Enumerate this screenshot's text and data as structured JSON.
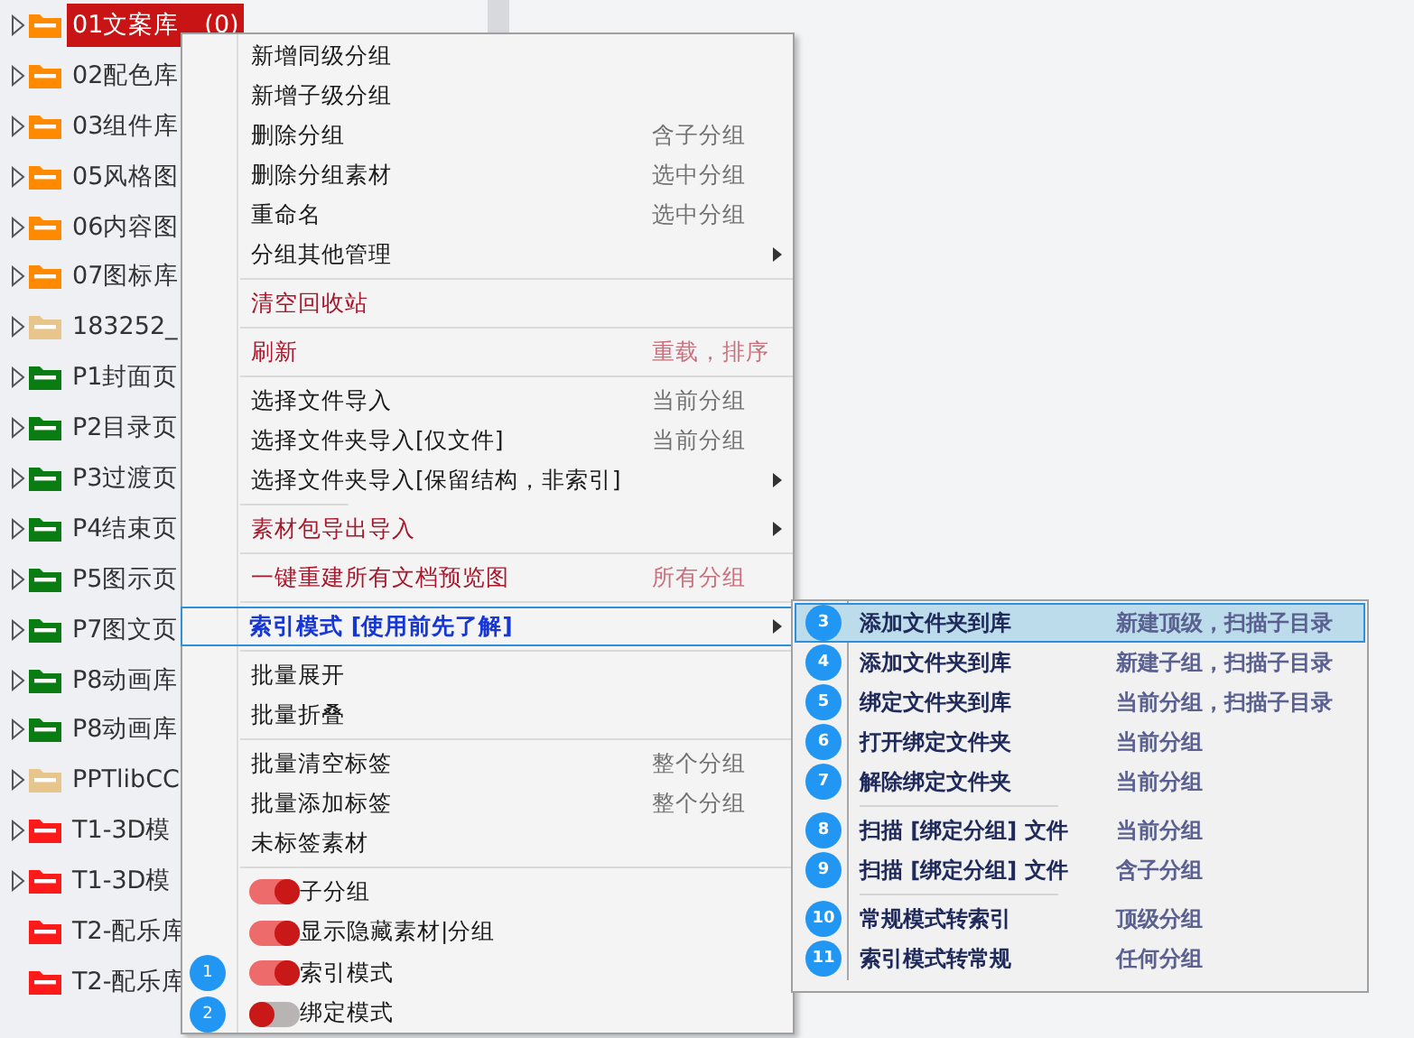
{
  "tree": [
    {
      "label": "01文案库　(0)",
      "color": "#ff8a00",
      "expandable": true,
      "selected": true
    },
    {
      "label": "02配色库",
      "color": "#ff8a00",
      "expandable": true,
      "selected": false
    },
    {
      "label": "03组件库",
      "color": "#ff8a00",
      "expandable": true,
      "selected": false
    },
    {
      "label": "05风格图",
      "color": "#ff8a00",
      "expandable": true,
      "selected": false
    },
    {
      "label": "06内容图",
      "color": "#ff8a00",
      "expandable": true,
      "selected": false
    },
    {
      "label": "07图标库",
      "color": "#ff8a00",
      "expandable": true,
      "selected": false
    },
    {
      "label": "183252_",
      "color": "#e8c58a",
      "expandable": true,
      "selected": false
    },
    {
      "label": "P1封面页",
      "color": "#0a7d12",
      "expandable": true,
      "selected": false
    },
    {
      "label": "P2目录页",
      "color": "#0a7d12",
      "expandable": true,
      "selected": false
    },
    {
      "label": "P3过渡页",
      "color": "#0a7d12",
      "expandable": true,
      "selected": false
    },
    {
      "label": "P4结束页",
      "color": "#0a7d12",
      "expandable": true,
      "selected": false
    },
    {
      "label": "P5图示页",
      "color": "#0a7d12",
      "expandable": true,
      "selected": false
    },
    {
      "label": "P7图文页",
      "color": "#0a7d12",
      "expandable": true,
      "selected": false
    },
    {
      "label": "P8动画库",
      "color": "#0a7d12",
      "expandable": true,
      "selected": false
    },
    {
      "label": "P8动画库",
      "color": "#0a7d12",
      "expandable": true,
      "selected": false
    },
    {
      "label": "PPTlibCC",
      "color": "#e8c58a",
      "expandable": true,
      "selected": false
    },
    {
      "label": "T1-3D模",
      "color": "#ff1a1a",
      "expandable": true,
      "selected": false
    },
    {
      "label": "T1-3D模",
      "color": "#ff1a1a",
      "expandable": true,
      "selected": false
    },
    {
      "label": "T2-配乐库",
      "color": "#ff1a1a",
      "expandable": false,
      "selected": false
    },
    {
      "label": "T2-配乐库",
      "color": "#ff1a1a",
      "expandable": false,
      "selected": false
    }
  ],
  "menu": [
    {
      "kind": "item",
      "label": "新增同级分组",
      "color": "#1a1a1a"
    },
    {
      "kind": "item",
      "label": "新增子级分组",
      "color": "#1a1a1a"
    },
    {
      "kind": "item",
      "label": "删除分组",
      "hint": "含子分组",
      "color": "#1a1a1a"
    },
    {
      "kind": "item",
      "label": "删除分组素材",
      "hint": "选中分组",
      "color": "#1a1a1a"
    },
    {
      "kind": "item",
      "label": "重命名",
      "hint": "选中分组",
      "color": "#1a1a1a"
    },
    {
      "kind": "item",
      "label": "分组其他管理",
      "color": "#1a1a1a",
      "submenu": true
    },
    {
      "kind": "separator"
    },
    {
      "kind": "item",
      "label": "清空回收站",
      "color": "#a8182c"
    },
    {
      "kind": "separator"
    },
    {
      "kind": "item",
      "label": "刷新",
      "hint": "重载，排序",
      "color": "#a8182c"
    },
    {
      "kind": "separator"
    },
    {
      "kind": "item",
      "label": "选择文件导入",
      "hint": "当前分组",
      "color": "#1a1a1a"
    },
    {
      "kind": "item",
      "label": "选择文件夹导入[仅文件]",
      "hint": "当前分组",
      "color": "#1a1a1a"
    },
    {
      "kind": "item",
      "label": "选择文件夹导入[保留结构，非索引]",
      "color": "#1a1a1a",
      "submenu": true
    },
    {
      "kind": "short-separator"
    },
    {
      "kind": "item",
      "label": "素材包导出导入",
      "color": "#a8182c",
      "submenu": true
    },
    {
      "kind": "separator"
    },
    {
      "kind": "item",
      "label": "一键重建所有文档预览图",
      "hint": "所有分组",
      "color": "#a8182c"
    },
    {
      "kind": "separator"
    },
    {
      "kind": "item",
      "label": "索引模式 [使用前先了解]",
      "color": "#1636d6",
      "bold": true,
      "submenu": true,
      "highlighted": true
    },
    {
      "kind": "separator"
    },
    {
      "kind": "item",
      "label": "批量展开",
      "color": "#1a1a1a"
    },
    {
      "kind": "item",
      "label": "批量折叠",
      "color": "#1a1a1a"
    },
    {
      "kind": "separator"
    },
    {
      "kind": "item",
      "label": "批量清空标签",
      "hint": "整个分组",
      "color": "#1a1a1a"
    },
    {
      "kind": "item",
      "label": "批量添加标签",
      "hint": "整个分组",
      "color": "#1a1a1a"
    },
    {
      "kind": "item",
      "label": "未标签素材",
      "color": "#1a1a1a"
    },
    {
      "kind": "separator"
    },
    {
      "kind": "toggle",
      "label": "子分组",
      "on": true
    },
    {
      "kind": "toggle",
      "label": "显示隐藏素材|分组",
      "on": true
    },
    {
      "kind": "toggle",
      "label": "索引模式",
      "on": true,
      "badge": "1"
    },
    {
      "kind": "toggle",
      "label": "绑定模式",
      "on": false,
      "badge": "2"
    }
  ],
  "submenu": [
    {
      "kind": "item",
      "badge": "3",
      "label": "添加文件夹到库",
      "hint": "新建顶级，扫描子目录",
      "selected": true
    },
    {
      "kind": "item",
      "badge": "4",
      "label": "添加文件夹到库",
      "hint": "新建子组，扫描子目录",
      "selected": false
    },
    {
      "kind": "item",
      "badge": "5",
      "label": "绑定文件夹到库",
      "hint": "当前分组，扫描子目录",
      "selected": false
    },
    {
      "kind": "item",
      "badge": "6",
      "label": "打开绑定文件夹",
      "hint": "当前分组",
      "selected": false
    },
    {
      "kind": "item",
      "badge": "7",
      "label": "解除绑定文件夹",
      "hint": "当前分组",
      "selected": false
    },
    {
      "kind": "separator"
    },
    {
      "kind": "item",
      "badge": "8",
      "label": "扫描 [绑定分组] 文件",
      "hint": "当前分组",
      "selected": false
    },
    {
      "kind": "item",
      "badge": "9",
      "label": "扫描 [绑定分组] 文件",
      "hint": "含子分组",
      "selected": false
    },
    {
      "kind": "separator"
    },
    {
      "kind": "item",
      "badge": "10",
      "label": "常规模式转索引",
      "hint": "顶级分组",
      "selected": false
    },
    {
      "kind": "item",
      "badge": "11",
      "label": "索引模式转常规",
      "hint": "任何分组",
      "selected": false
    }
  ]
}
